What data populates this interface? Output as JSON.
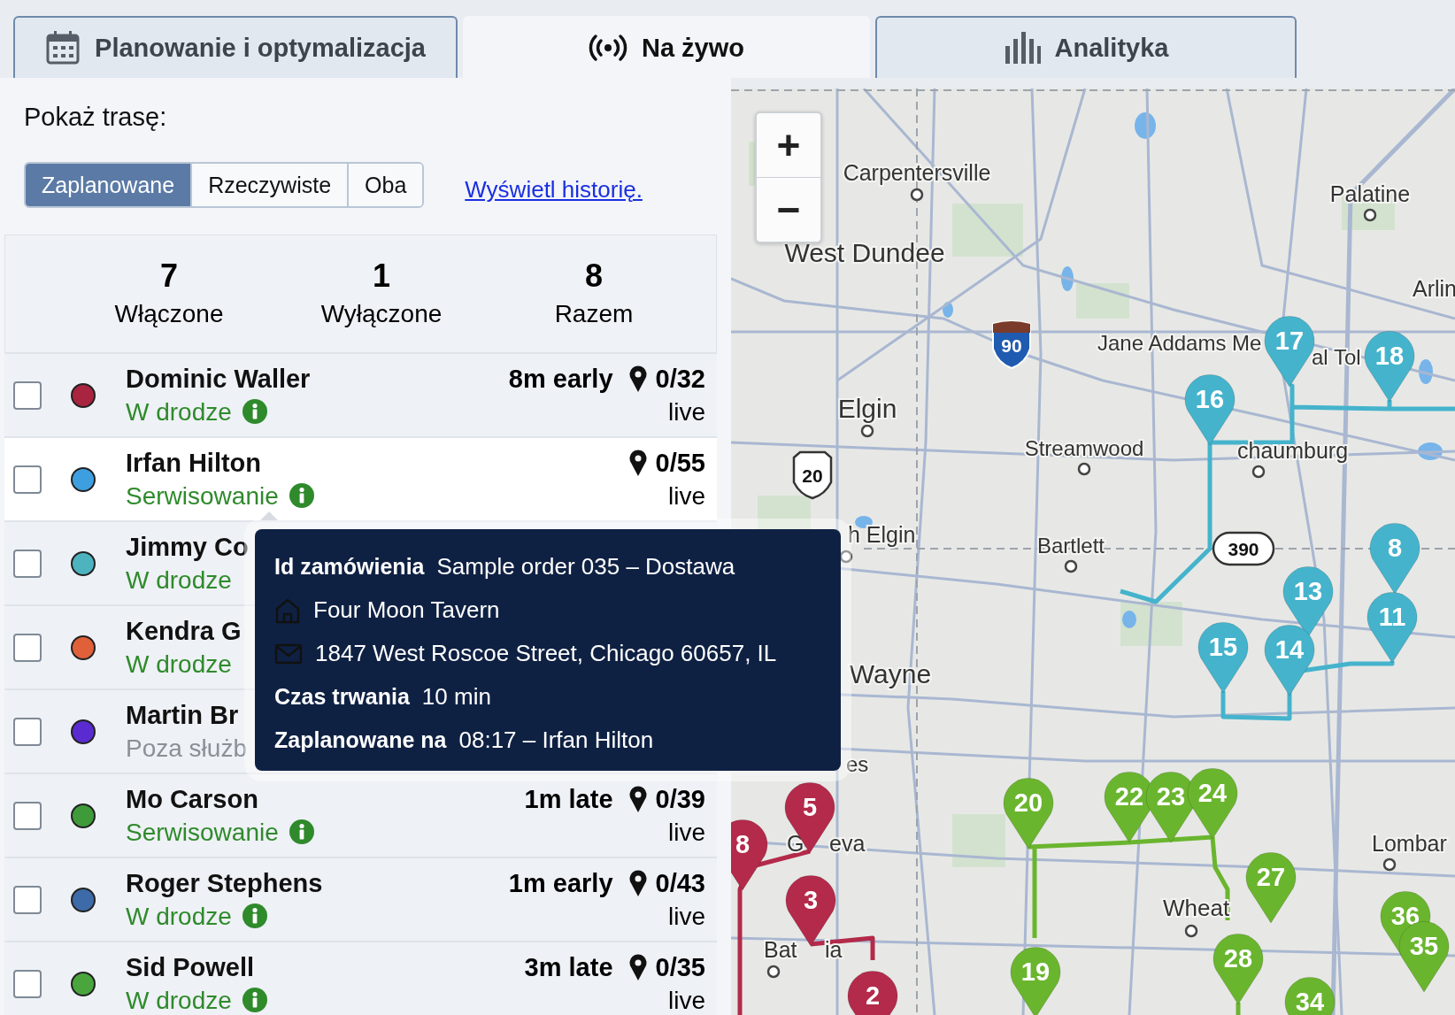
{
  "tabs": [
    {
      "label": "Planowanie i optymalizacja",
      "selected": false
    },
    {
      "label": "Na żywo",
      "selected": true
    },
    {
      "label": "Analityka",
      "selected": false
    }
  ],
  "route_panel": {
    "title": "Pokaż trasę:",
    "route_toggle": [
      {
        "label": "Zaplanowane",
        "selected": true
      },
      {
        "label": "Rzeczywiste",
        "selected": false
      },
      {
        "label": "Oba",
        "selected": false
      }
    ],
    "history_link": "Wyświetl historię.",
    "stats": [
      {
        "value": "7",
        "label": "Włączone"
      },
      {
        "value": "1",
        "label": "Wyłączone"
      },
      {
        "value": "8",
        "label": "Razem"
      }
    ]
  },
  "drivers": [
    {
      "name": "Dominic Waller",
      "color": "#a8243f",
      "status": "W drodze",
      "on_duty": true,
      "info": true,
      "delta": "8m early",
      "stops": "0/32",
      "tracking": "live",
      "checked": false,
      "selected": false
    },
    {
      "name": "Irfan Hilton",
      "color": "#3e9fe0",
      "status": "Serwisowanie",
      "on_duty": true,
      "info": true,
      "stops": "0/55",
      "tracking": "live",
      "checked": false,
      "selected": true
    },
    {
      "name": "Jimmy Co",
      "color": "#4db3bf",
      "status": "W drodze",
      "on_duty": true,
      "checked": false,
      "selected": false
    },
    {
      "name": "Kendra G",
      "color": "#e0603a",
      "status": "W drodze",
      "on_duty": true,
      "checked": false,
      "selected": false
    },
    {
      "name": "Martin Br",
      "color": "#5a2bd0",
      "status": "Poza służb",
      "on_duty": false,
      "checked": false,
      "selected": false
    },
    {
      "name": "Mo Carson",
      "color": "#3f9a3a",
      "status": "Serwisowanie",
      "on_duty": true,
      "info": true,
      "delta": "1m late",
      "stops": "0/39",
      "tracking": "live",
      "checked": false,
      "selected": false
    },
    {
      "name": "Roger Stephens",
      "color": "#3d6aa8",
      "status": "W drodze",
      "on_duty": true,
      "info": true,
      "delta": "1m early",
      "stops": "0/43",
      "tracking": "live",
      "checked": false,
      "selected": false
    },
    {
      "name": "Sid Powell",
      "color": "#4aa63c",
      "status": "W drodze",
      "on_duty": true,
      "info": true,
      "delta": "3m late",
      "stops": "0/35",
      "tracking": "live",
      "checked": false,
      "selected": false
    }
  ],
  "order_tooltip": {
    "lines": [
      {
        "kind": "field",
        "label": "Id zamówienia",
        "value": "Sample order 035 – Dostawa"
      },
      {
        "kind": "place",
        "text": "Four Moon Tavern"
      },
      {
        "kind": "address",
        "text": "1847 West Roscoe Street, Chicago 60657, IL"
      },
      {
        "kind": "field",
        "label": "Czas trwania",
        "value": "10 min"
      },
      {
        "kind": "field",
        "label": "Zaplanowane na",
        "value": "08:17 – Irfan Hilton"
      }
    ]
  },
  "map": {
    "zoom_in": "+",
    "zoom_out": "−",
    "place_labels": [
      "Carpentersville",
      "Palatine",
      "West Dundee",
      "Arlin",
      "Jane Addams Me",
      "al Tol",
      "Elgin",
      "Streamwood",
      "chaumburg",
      "h Elgin",
      "Bartlett",
      "Wayne",
      "es",
      "G",
      "eva",
      "Bat",
      "ia",
      "Wheat",
      "Lombar"
    ],
    "road_shields": [
      "90",
      "20",
      "390"
    ],
    "routes": [
      {
        "color": "#45b3cc",
        "pins": [
          "16",
          "17",
          "18",
          "8",
          "13",
          "11",
          "15",
          "14"
        ]
      },
      {
        "color": "#b32a4a",
        "pins": [
          "5",
          "8",
          "3",
          "2"
        ]
      },
      {
        "color": "#6ab52e",
        "pins": [
          "20",
          "22",
          "23",
          "24",
          "27",
          "19",
          "28",
          "36",
          "35",
          "34"
        ]
      }
    ]
  }
}
